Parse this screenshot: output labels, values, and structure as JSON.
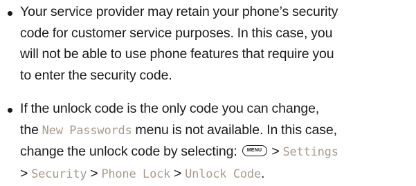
{
  "bullets": [
    {
      "lines": [
        "Your service provider may retain your phone’s security",
        "code for customer service purposes. In this case, you",
        "will not be able to use phone features that require you",
        "to enter the security code."
      ]
    },
    {
      "line1": "If the unlock code is the only code you can change,",
      "line2_prefix": "the ",
      "line2_term": "New Passwords",
      "line2_suffix": " menu is not available. In this case,",
      "line3_prefix": "change the unlock code by selecting: ",
      "menu_key_label": "MENU",
      "line3_sep": " > ",
      "line3_term": "Settings",
      "line4_start": "> ",
      "line4_term1": "Security",
      "line4_sep1": " > ",
      "line4_term2": "Phone Lock",
      "line4_sep2": " > ",
      "line4_term3": "Unlock Code",
      "line4_end": "."
    }
  ]
}
